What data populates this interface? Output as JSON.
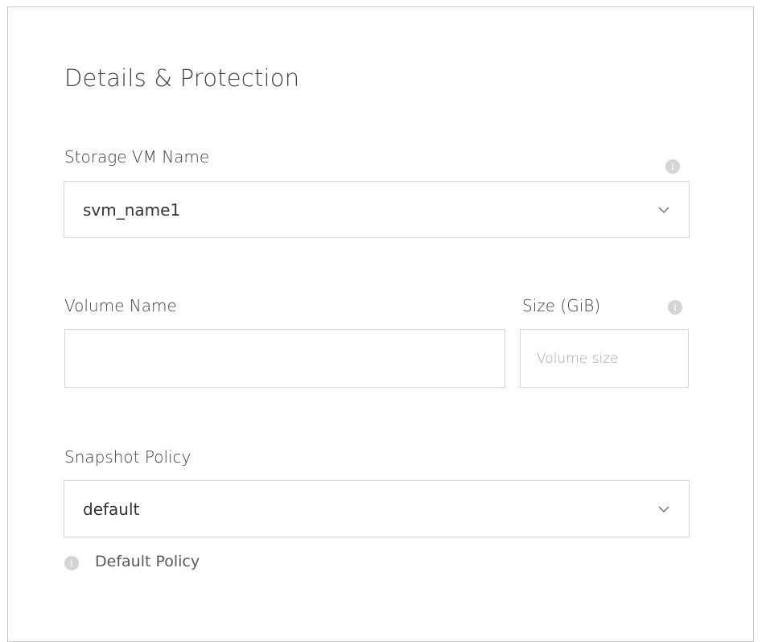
{
  "section": {
    "title": "Details & Protection"
  },
  "storage_vm": {
    "label": "Storage VM Name",
    "selected": "svm_name1"
  },
  "volume_name": {
    "label": "Volume Name",
    "value": ""
  },
  "size": {
    "label": "Size (GiB)",
    "placeholder": "Volume size"
  },
  "snapshot_policy": {
    "label": "Snapshot Policy",
    "selected": "default",
    "note": "Default Policy"
  },
  "icons": {
    "info": "info-icon",
    "dropdown": "chevron-down-icon"
  },
  "colors": {
    "border": "#d6d6d6",
    "info_icon": "#d4d4d4",
    "text": "#404040"
  }
}
